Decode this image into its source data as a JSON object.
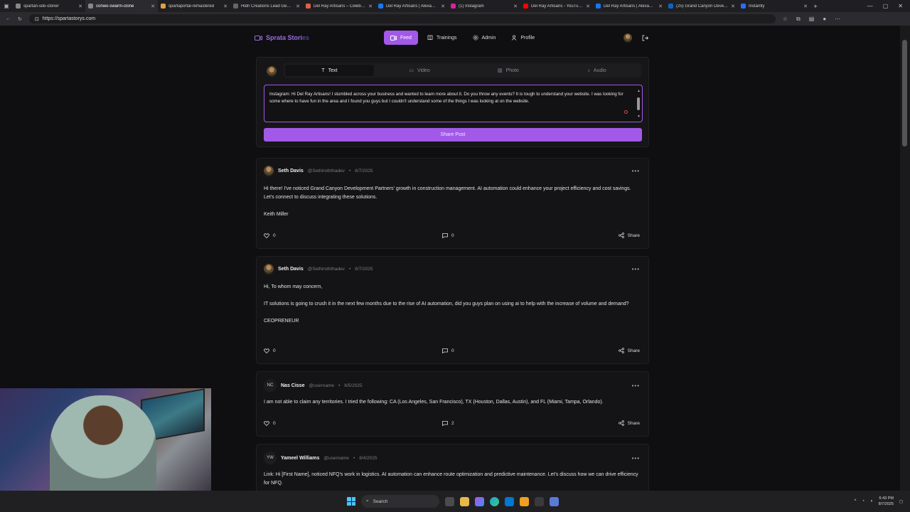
{
  "browser": {
    "tabs": [
      {
        "title": "spartan-site-cloner",
        "color": "#888888",
        "active": false
      },
      {
        "title": "conwo-swarm-clone",
        "color": "#888888",
        "active": true
      },
      {
        "title": "spartaportal-remastered",
        "color": "#e0a040",
        "active": false
      },
      {
        "title": "Hidn Creations Lead Genera...",
        "color": "#666666",
        "active": false
      },
      {
        "title": "Del Ray Artisans – Celebrati...",
        "color": "#e06040",
        "active": false
      },
      {
        "title": "Del Ray Artisans | Alexandri...",
        "color": "#1877f2",
        "active": false
      },
      {
        "title": "(1) Instagram",
        "color": "#d6249f",
        "active": false
      },
      {
        "title": "Del Ray Artisans - YouTube",
        "color": "#ff0000",
        "active": false
      },
      {
        "title": "Del Ray Artisans | Alexandri...",
        "color": "#1877f2",
        "active": false
      },
      {
        "title": "(25) Grand Canyon Develop...",
        "color": "#0a66c2",
        "active": false
      },
      {
        "title": "Instantly",
        "color": "#2f6bff",
        "active": false
      }
    ],
    "url": "https://spartastorys.com"
  },
  "nav": {
    "brand": "Sprata Stori",
    "brand_faded": "es",
    "items": [
      {
        "label": "Feed",
        "icon": "video-icon",
        "active": true
      },
      {
        "label": "Trainings",
        "icon": "book-icon",
        "active": false
      },
      {
        "label": "Admin",
        "icon": "gear-icon",
        "active": false
      },
      {
        "label": "Profile",
        "icon": "user-icon",
        "active": false
      }
    ]
  },
  "composer": {
    "tabs": [
      {
        "label": "Text",
        "active": true
      },
      {
        "label": "Video",
        "active": false
      },
      {
        "label": "Photo",
        "active": false
      },
      {
        "label": "Audio",
        "active": false
      }
    ],
    "text": "Instagram: Hi Del Ray Artisans! I stumbled across your business and wanted to learn more about it. Do you throw any events? It is tough to understand your website. I was looking for some where to have fun in the area and I found you guys but I couldn't understand some of the things I was looking at on the website.",
    "share_label": "Share Post"
  },
  "posts": [
    {
      "name": "Seth Davis",
      "handle": "@Sethiroththadev",
      "date": "8/7/2025",
      "avatar": "image",
      "paragraphs": [
        "Hi there! I've noticed Grand Canyon Development Partners' growth in construction management. AI automation could enhance your project efficiency and cost savings. Let's connect to discuss integrating these solutions.",
        "Keith Miller"
      ],
      "likes": "0",
      "comments": "0",
      "share": "Share"
    },
    {
      "name": "Seth Davis",
      "handle": "@Sethiroththadev",
      "date": "8/7/2025",
      "avatar": "image",
      "paragraphs": [
        "Hi, To whom may concern,",
        "IT solutions is going to crush it in the next few months due to the rise of AI automation, did you guys plan on using ai to help with the increase of volume and demand?",
        "CEOPRENEUR"
      ],
      "likes": "0",
      "comments": "0",
      "share": "Share"
    },
    {
      "name": "Nas Cisse",
      "handle": "@username",
      "date": "8/5/2025",
      "avatar": "NC",
      "paragraphs": [
        "I am not able to claim any territories. I tried the following: CA (Los Angeles, San Francisco), TX (Houston, Dallas, Austin), and FL (Miami, Tampa, Orlando)."
      ],
      "likes": "0",
      "comments": "2",
      "share": "Share"
    },
    {
      "name": "Yameel Williams",
      "handle": "@username",
      "date": "8/4/2025",
      "avatar": "YW",
      "paragraphs": [
        "Link: Hi [First Name], noticed NFQ's work in logistics. AI automation can enhance route optimization and predictive maintenance. Let's discuss how we can drive efficiency for NFQ."
      ],
      "likes": "",
      "comments": "",
      "share": ""
    }
  ],
  "taskbar": {
    "search_placeholder": "Search",
    "time": "6:43 PM",
    "date": "8/7/2025"
  },
  "colors": {
    "accent": "#a259e8",
    "background": "#0f0f11",
    "card": "#141416"
  }
}
